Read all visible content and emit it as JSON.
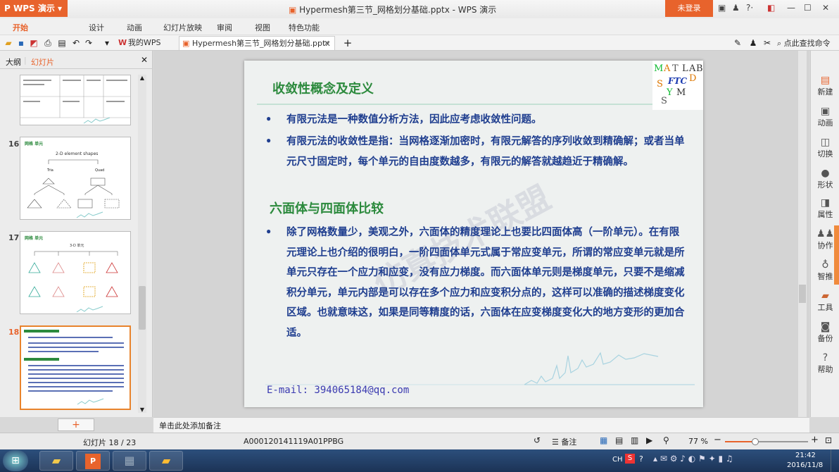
{
  "window": {
    "app_menu": "WPS 演示",
    "title": "Hypermesh第三节_网格划分基础.pptx - WPS 演示",
    "login": "未登录"
  },
  "menu": [
    {
      "label": "开始"
    },
    {
      "label": "设计"
    },
    {
      "label": "动画"
    },
    {
      "label": "幻灯片放映"
    },
    {
      "label": "审阅"
    },
    {
      "label": "视图"
    },
    {
      "label": "特色功能"
    }
  ],
  "tabs": {
    "mywps": "我的WPS",
    "doc": "Hypermesh第三节_网格划分基础.pptx",
    "search": "点此查找命令"
  },
  "sidepanel": {
    "tab_outline": "大纲",
    "tab_slides": "幻灯片",
    "add_label": "+",
    "slides": [
      {
        "num": "16",
        "title": "2-D element shapes",
        "sub1": "Tria",
        "sub2": "Quad"
      },
      {
        "num": "17",
        "title": "3-D 单元"
      },
      {
        "num": "18"
      }
    ]
  },
  "slide": {
    "title": "收敛性概念及定义",
    "bullets1": [
      "有限元法是一种数值分析方法，因此应考虑收敛性问题。",
      "有限元法的收敛性是指：当网格逐渐加密时，有限元解答的序列收敛到精确解；或者当单元尺寸固定时，每个单元的自由度数越多，有限元的解答就越趋近于精确解。"
    ],
    "subtitle": "六面体与四面体比较",
    "bullets2": [
      "除了网格数量少，美观之外，六面体的精度理论上也要比四面体高（一阶单元）。在有限元理论上也介绍的很明白，一阶四面体单元式属于常应变单元，所谓的常应变单元就是所单元只存在一个应力和应变，没有应力梯度。而六面体单元则是梯度单元，只要不是缩减积分单元，单元内部是可以存在多个应力和应变积分点的，这样可以准确的描述梯度变化区域。也就意味这，如果是同等精度的话，六面体在应变梯度变化大的地方变形的更加合适。"
    ],
    "email": "E-mail: 394065184@qq.com",
    "logo": {
      "letters": [
        "M",
        "A",
        "T",
        "L",
        "A",
        "B",
        "S",
        "Y",
        "M",
        "S",
        "D"
      ],
      "center": "FTC"
    },
    "watermark": "仿真技术联盟"
  },
  "rightbar": [
    {
      "label": "新建",
      "icon": "new-icon"
    },
    {
      "label": "动画",
      "icon": "animation-icon"
    },
    {
      "label": "切换",
      "icon": "transition-icon"
    },
    {
      "label": "形状",
      "icon": "shape-icon"
    },
    {
      "label": "属性",
      "icon": "property-icon"
    },
    {
      "label": "协作",
      "icon": "collab-icon"
    },
    {
      "label": "智推",
      "icon": "bulb-icon"
    },
    {
      "label": "工具",
      "icon": "toolbox-icon"
    },
    {
      "label": "备份",
      "icon": "backup-icon"
    },
    {
      "label": "帮助",
      "icon": "help-icon"
    }
  ],
  "notes": "单击此处添加备注",
  "status": {
    "slide_count": "幻灯片 18 / 23",
    "template": "A000120141119A01PPBG",
    "notes_btn": "备注",
    "zoom": "77 %"
  },
  "taskbar": {
    "lang": "CH",
    "time": "21:42",
    "date": "2016/11/8"
  }
}
